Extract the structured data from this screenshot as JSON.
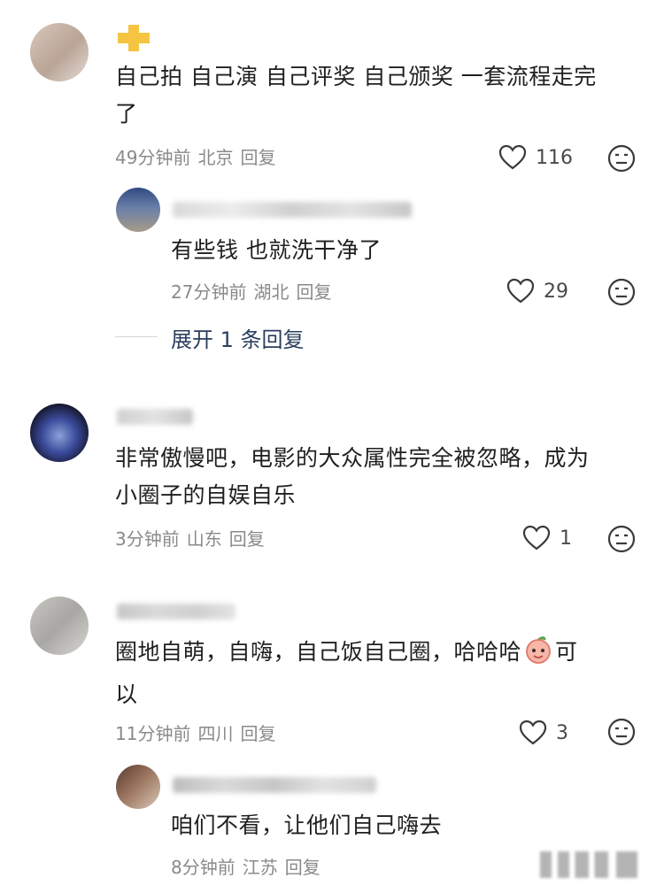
{
  "comments": [
    {
      "text_line1": "自己拍 自己演 自己评奖 自己颁奖 一套流程走完",
      "text_line2": "了",
      "time": "49分钟前",
      "location": "北京",
      "reply_label": "回复",
      "likes": "116"
    },
    {
      "text": "有些钱 也就洗干净了",
      "time": "27分钟前",
      "location": "湖北",
      "reply_label": "回复",
      "likes": "29"
    },
    {
      "text_line1": "非常傲慢吧，电影的大众属性完全被忽略，成为",
      "text_line2": "小圈子的自娱自乐",
      "time": "3分钟前",
      "location": "山东",
      "reply_label": "回复",
      "likes": "1"
    },
    {
      "text_line1": "圈地自萌，自嗨，自己饭自己圈，哈哈哈",
      "text_line1_tail": "可",
      "text_line2": "以",
      "time": "11分钟前",
      "location": "四川",
      "reply_label": "回复",
      "likes": "3"
    },
    {
      "text": "咱们不看，让他们自己嗨去",
      "time": "8分钟前",
      "location": "江苏",
      "reply_label": "回复"
    }
  ],
  "expand_replies": "展开 1 条回复",
  "icons": {
    "like": "heart-outline-icon",
    "react": "neutral-face-icon",
    "emoji": "peach-face-emoji",
    "badge": "plus-badge-icon"
  },
  "colors": {
    "badge": "#f5c542",
    "expand_text": "#2a3f5c",
    "meta_text": "#8a8a8a"
  }
}
